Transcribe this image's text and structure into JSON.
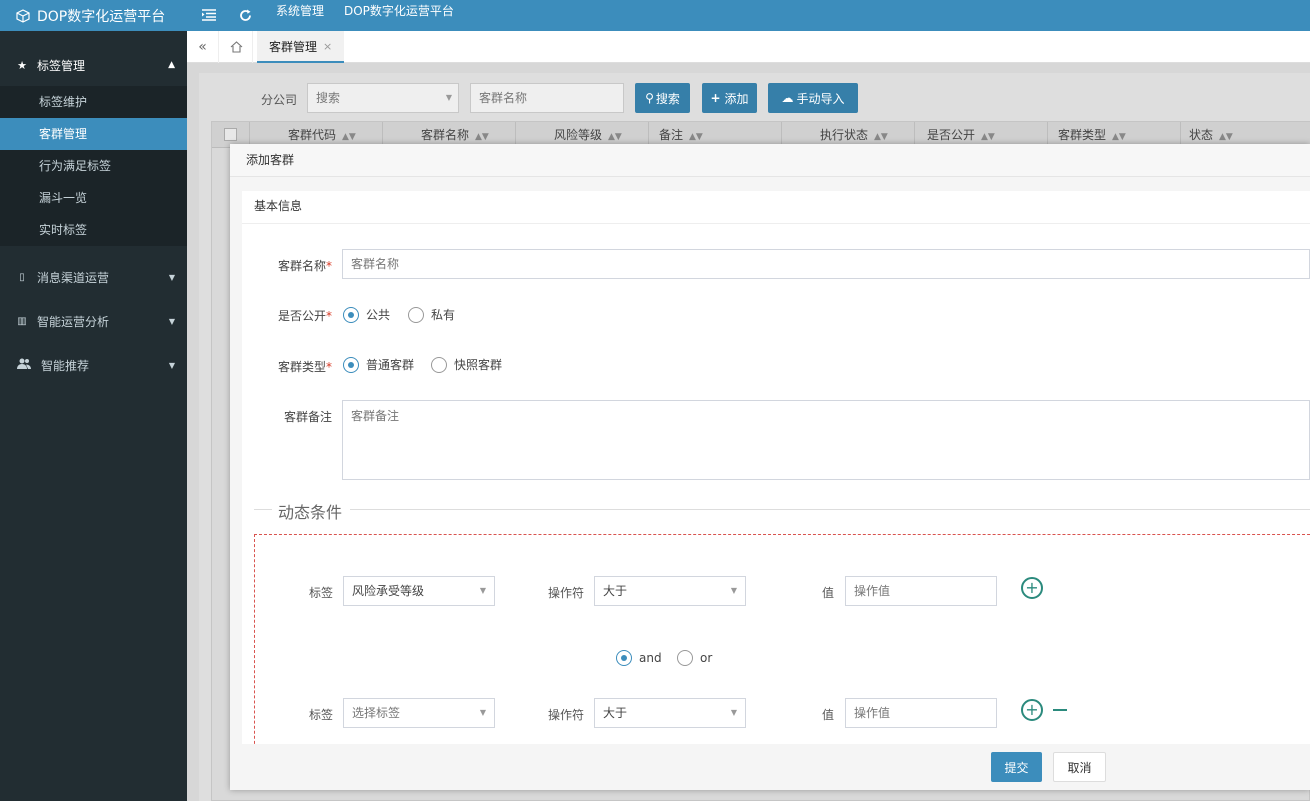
{
  "topbar": {
    "brand": "DOP数字化运营平台",
    "menu_icon": "list-icon",
    "refresh_icon": "refresh-icon",
    "links": [
      "系统管理",
      "DOP数字化运营平台"
    ]
  },
  "sidebar": {
    "group_active": {
      "label": "标签管理",
      "icon": "star-icon"
    },
    "sub_items": [
      "标签维护",
      "客群管理",
      "行为满足标签",
      "漏斗一览",
      "实时标签"
    ],
    "groups": [
      {
        "label": "消息渠道运营",
        "icon": "mobile-icon"
      },
      {
        "label": "智能运营分析",
        "icon": "chart-icon"
      },
      {
        "label": "智能推荐",
        "icon": "users-icon"
      }
    ]
  },
  "tabs": {
    "active": "客群管理",
    "close": "×"
  },
  "search": {
    "branch_label": "分公司",
    "branch_placeholder": "搜索",
    "name_placeholder": "客群名称",
    "search_button": "搜索",
    "add_button": "添加",
    "import_button": "手动导入"
  },
  "grid": {
    "columns": [
      "客群代码",
      "客群名称",
      "风险等级",
      "备注",
      "执行状态",
      "是否公开",
      "客群类型",
      "状态"
    ]
  },
  "modal": {
    "title": "添加客群",
    "section_title": "基本信息",
    "name_label": "客群名称",
    "name_placeholder": "客群名称",
    "public_label": "是否公开",
    "public_options": [
      "公共",
      "私有"
    ],
    "type_label": "客群类型",
    "type_options": [
      "普通客群",
      "快照客群"
    ],
    "remark_label": "客群备注",
    "remark_placeholder": "客群备注",
    "dynamic_legend": "动态条件",
    "conditions": [
      {
        "tag_label": "标签",
        "tag_value": "风险承受等级",
        "op_label": "操作符",
        "op_value": "大于",
        "val_label": "值",
        "val_placeholder": "操作值"
      },
      {
        "tag_label": "标签",
        "tag_value": "选择标签",
        "op_label": "操作符",
        "op_value": "大于",
        "val_label": "值",
        "val_placeholder": "操作值"
      }
    ],
    "logic_options": [
      "and",
      "or"
    ],
    "submit": "提交",
    "cancel": "取消"
  }
}
